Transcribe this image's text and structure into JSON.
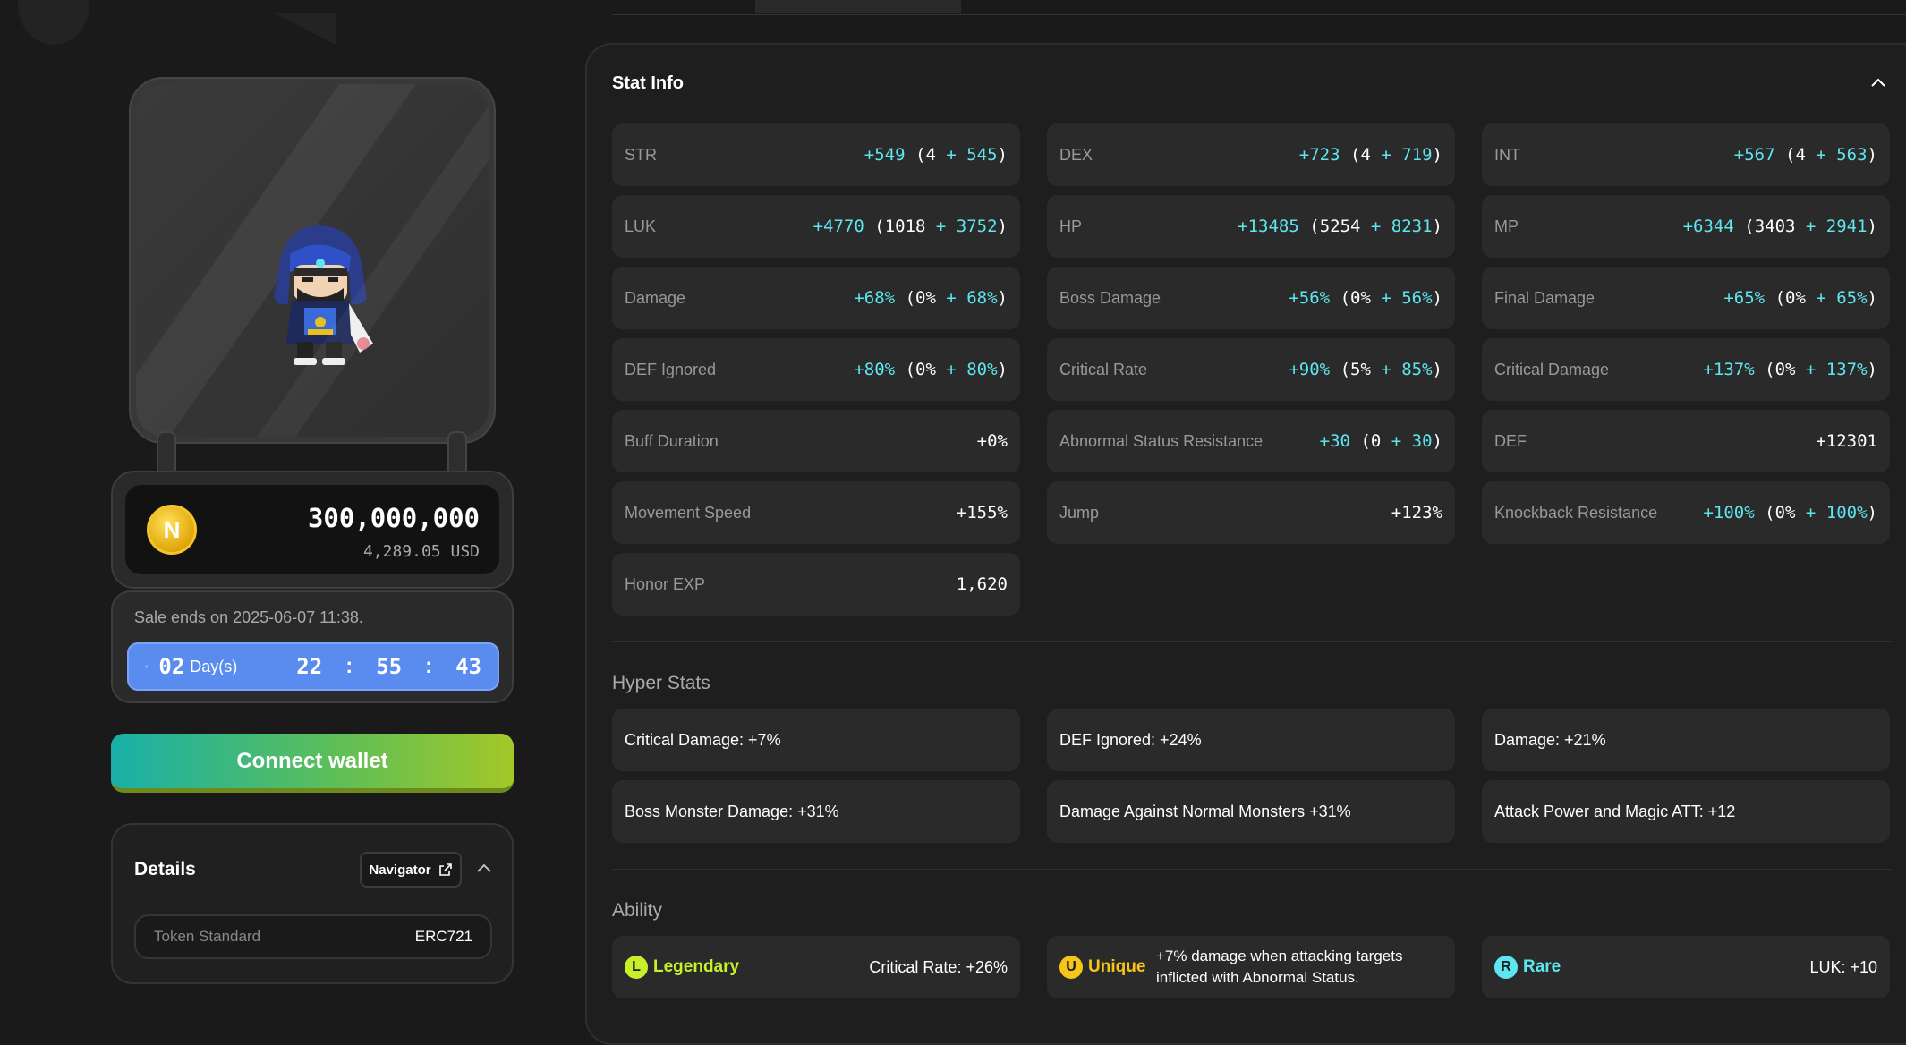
{
  "price": {
    "amount": "300,000,000",
    "usd": "4,289.05 USD",
    "coin_glyph": "N"
  },
  "sale": {
    "ends_text": "Sale ends on 2025-06-07 11:38.",
    "days": "02",
    "days_label": "Day(s)",
    "hours": "22",
    "minutes": "55",
    "seconds": "43",
    "sep": ":"
  },
  "connect_label": "Connect wallet",
  "details": {
    "title": "Details",
    "navigator_label": "Navigator",
    "token_key": "Token Standard",
    "token_value": "ERC721"
  },
  "stat_info": {
    "title": "Stat Info",
    "rows": [
      [
        {
          "k": "STR",
          "pre": "+549",
          "paren": "(4 + 545)"
        },
        {
          "k": "DEX",
          "pre": "+723",
          "paren": "(4 + 719)"
        },
        {
          "k": "INT",
          "pre": "+567",
          "paren": "(4 + 563)"
        }
      ],
      [
        {
          "k": "LUK",
          "pre": "+4770",
          "paren": "(1018 + 3752)"
        },
        {
          "k": "HP",
          "pre": "+13485",
          "paren": "(5254 + 8231)"
        },
        {
          "k": "MP",
          "pre": "+6344",
          "paren": "(3403 + 2941)"
        }
      ],
      [
        {
          "k": "Damage",
          "pre": "+68%",
          "paren": "(0% + 68%)"
        },
        {
          "k": "Boss Damage",
          "pre": "+56%",
          "paren": "(0% + 56%)"
        },
        {
          "k": "Final Damage",
          "pre": "+65%",
          "paren": "(0% + 65%)"
        }
      ],
      [
        {
          "k": "DEF Ignored",
          "pre": "+80%",
          "paren": "(0% + 80%)"
        },
        {
          "k": "Critical Rate",
          "pre": "+90%",
          "paren": "(5% + 85%)"
        },
        {
          "k": "Critical Damage",
          "pre": "+137%",
          "paren": "(0% + 137%)"
        }
      ],
      [
        {
          "k": "Buff Duration",
          "plain": "+0%"
        },
        {
          "k": "Abnormal Status Resistance",
          "pre": "+30",
          "paren": "(0 + 30)"
        },
        {
          "k": "DEF",
          "plain": "+12301"
        }
      ],
      [
        {
          "k": "Movement Speed",
          "plain": "+155%"
        },
        {
          "k": "Jump",
          "plain": "+123%"
        },
        {
          "k": "Knockback Resistance",
          "pre": "+100%",
          "paren": "(0% + 100%)"
        }
      ],
      [
        {
          "k": "Honor EXP",
          "plain": "1,620"
        }
      ]
    ]
  },
  "hyper_stats": {
    "title": "Hyper Stats",
    "items": [
      "Critical Damage: +7%",
      "DEF Ignored: +24%",
      "Damage: +21%",
      "Boss Monster Damage: +31%",
      "Damage Against Normal Monsters +31%",
      "Attack Power and Magic ATT: +12"
    ]
  },
  "ability": {
    "title": "Ability",
    "items": [
      {
        "glyph": "L",
        "grade": "Legendary",
        "color": "#c8f02a",
        "text": "Critical Rate: +26%"
      },
      {
        "glyph": "U",
        "grade": "Unique",
        "color": "#f5c518",
        "text": "+7% damage when attacking targets inflicted with Abnormal Status."
      },
      {
        "glyph": "R",
        "grade": "Rare",
        "color": "#5ee6f0",
        "text": "LUK: +10"
      }
    ]
  }
}
